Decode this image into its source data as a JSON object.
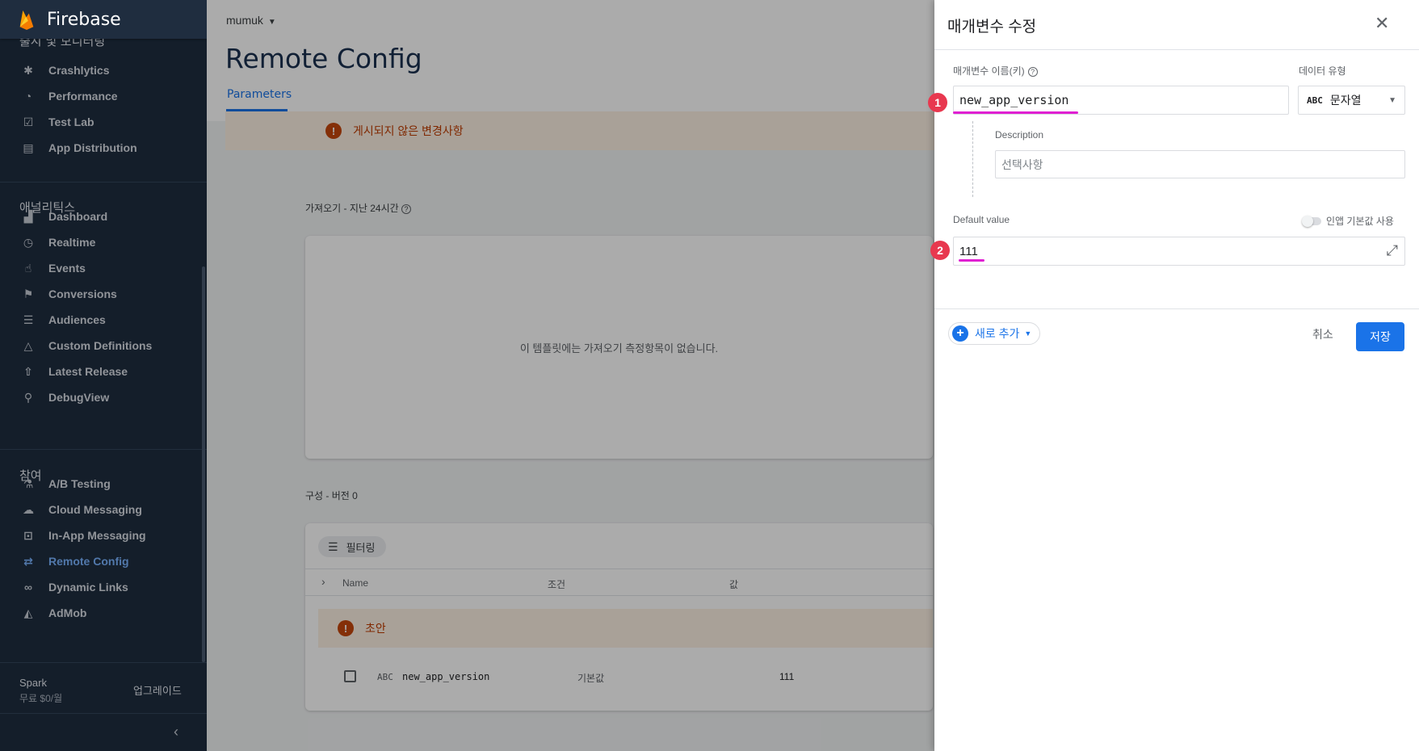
{
  "brand": {
    "name": "Firebase"
  },
  "sidebar": {
    "cut_header": "출시 및 모니터링",
    "release_items": [
      {
        "label": "Crashlytics",
        "icon": "crashlytics-icon"
      },
      {
        "label": "Performance",
        "icon": "performance-icon"
      },
      {
        "label": "Test Lab",
        "icon": "test-lab-icon"
      },
      {
        "label": "App Distribution",
        "icon": "app-distribution-icon"
      }
    ],
    "analytics_title": "애널리틱스",
    "analytics_items": [
      {
        "label": "Dashboard",
        "icon": "bar-chart-icon"
      },
      {
        "label": "Realtime",
        "icon": "clock-icon"
      },
      {
        "label": "Events",
        "icon": "touch-icon"
      },
      {
        "label": "Conversions",
        "icon": "flag-icon"
      },
      {
        "label": "Audiences",
        "icon": "audience-icon"
      },
      {
        "label": "Custom Definitions",
        "icon": "shapes-icon"
      },
      {
        "label": "Latest Release",
        "icon": "rocket-icon"
      },
      {
        "label": "DebugView",
        "icon": "debug-icon"
      }
    ],
    "engage_title": "참여",
    "engage_items": [
      {
        "label": "A/B Testing",
        "icon": "flask-icon"
      },
      {
        "label": "Cloud Messaging",
        "icon": "cloud-icon"
      },
      {
        "label": "In-App Messaging",
        "icon": "in-app-icon"
      },
      {
        "label": "Remote Config",
        "icon": "remote-config-icon",
        "active": true
      },
      {
        "label": "Dynamic Links",
        "icon": "link-icon"
      },
      {
        "label": "AdMob",
        "icon": "admob-icon"
      }
    ],
    "plan": "Spark",
    "plan_price": "무료 $0/월",
    "upgrade": "업그레이드"
  },
  "main": {
    "project": "mumuk",
    "title": "Remote Config",
    "tab": "Parameters",
    "unpublished_banner": "게시되지 않은 변경사항",
    "fetch_title": "가져오기 - 지난 24시간",
    "fetch_empty": "이 템플릿에는 가져오기 측정항목이 없습니다.",
    "config_title": "구성 - 버전 0",
    "filter_label": "필터링",
    "columns": {
      "name": "Name",
      "condition": "조건",
      "value": "값"
    },
    "draft_label": "초안",
    "row": {
      "type": "ABC",
      "name": "new_app_version",
      "condition": "기본값",
      "value": "111"
    }
  },
  "panel": {
    "title": "매개변수 수정",
    "param_name_label": "매개변수 이름(키)",
    "param_name_value": "new_app_version",
    "data_type_label": "데이터 유형",
    "data_type_value": "문자열",
    "data_type_icon": "ABC",
    "description_label": "Description",
    "description_placeholder": "선택사항",
    "default_value_label": "Default value",
    "in_app_default_label": "인앱 기본값 사용",
    "default_value": "111",
    "add_new": "새로 추가",
    "cancel": "취소",
    "save": "저장"
  },
  "annotations": {
    "badge1": "1",
    "badge2": "2",
    "color": "#e8384f",
    "underline_color": "#e020d2"
  },
  "colors": {
    "sidebar_bg": "#1f2d3f",
    "accent": "#1a73e8",
    "warning": "#bf3c00"
  }
}
